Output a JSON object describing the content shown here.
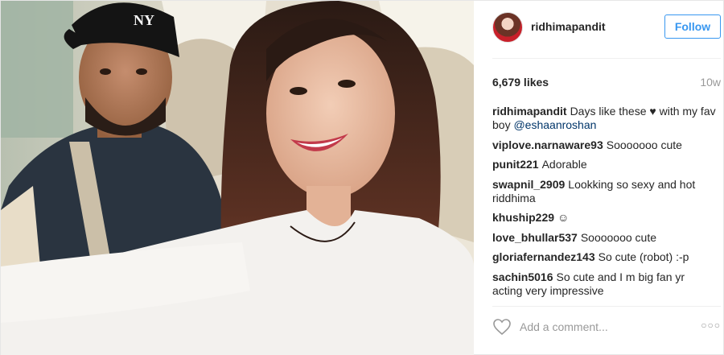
{
  "post": {
    "username": "ridhimapandit",
    "follow_label": "Follow",
    "likes": "6,679 likes",
    "time_ago": "10w",
    "caption": {
      "user": "ridhimapandit",
      "text_before": "Days like these",
      "heart": "♥",
      "text_after": "with my fav boy",
      "mention": "@eshaanroshan"
    },
    "comments": [
      {
        "user": "viplove.narnaware93",
        "text": "Sooooooo cute"
      },
      {
        "user": "punit221",
        "text": "Adorable"
      },
      {
        "user": "swapnil_2909",
        "text": "Lookking so sexy and hot riddhima"
      },
      {
        "user": "khuship229",
        "text": "☺"
      },
      {
        "user": "love_bhullar537",
        "text": "Sooooooo cute"
      },
      {
        "user": "gloriafernandez143",
        "text": "So cute (robot) :-p"
      },
      {
        "user": "sachin5016",
        "text": "So cute and I m big fan yr acting very impressive"
      }
    ],
    "add_comment_placeholder": "Add a comment...",
    "more_label": "○○○"
  },
  "colors": {
    "follow_blue": "#3897f0",
    "mention_blue": "#003569",
    "muted_gray": "#999999",
    "divider": "#efefef"
  },
  "icons": {
    "like": "heart-outline-icon",
    "more": "ellipsis-icon",
    "avatar": "profile-avatar"
  }
}
